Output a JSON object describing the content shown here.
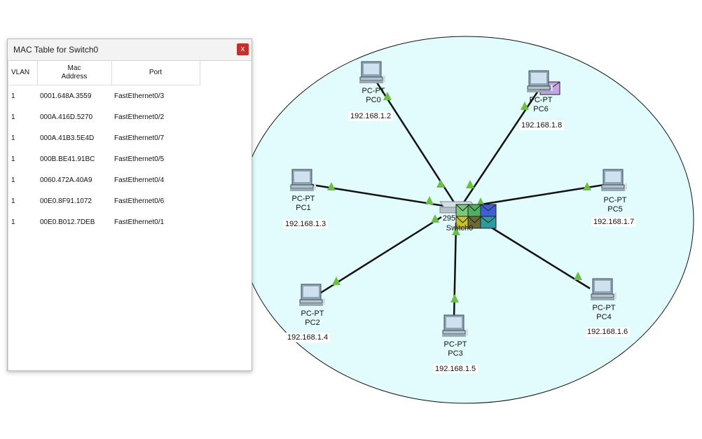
{
  "mac_window": {
    "title": "MAC Table for Switch0",
    "close_label": "x",
    "columns": {
      "vlan": "VLAN",
      "mac_line1": "Mac",
      "mac_line2": "Address",
      "port": "Port"
    },
    "rows": [
      {
        "vlan": "1",
        "mac": "0001.648A.3559",
        "port": "FastEthernet0/3"
      },
      {
        "vlan": "1",
        "mac": "000A.416D.5270",
        "port": "FastEthernet0/2"
      },
      {
        "vlan": "1",
        "mac": "000A.41B3.5E4D",
        "port": "FastEthernet0/7"
      },
      {
        "vlan": "1",
        "mac": "000B.BE41.91BC",
        "port": "FastEthernet0/5"
      },
      {
        "vlan": "1",
        "mac": "0060.472A.40A9",
        "port": "FastEthernet0/4"
      },
      {
        "vlan": "1",
        "mac": "00E0.8F91.1072",
        "port": "FastEthernet0/6"
      },
      {
        "vlan": "1",
        "mac": "00E0.B012.7DEB",
        "port": "FastEthernet0/1"
      }
    ]
  },
  "topology": {
    "switch": {
      "model": "295",
      "name": "Switch0"
    },
    "pcs": [
      {
        "type": "PC-PT",
        "name": "PC0",
        "ip": "192.168.1.2"
      },
      {
        "type": "PC-PT",
        "name": "PC1",
        "ip": "192.168.1.3"
      },
      {
        "type": "PC-PT",
        "name": "PC2",
        "ip": "192.168.1.4"
      },
      {
        "type": "PC-PT",
        "name": "PC3",
        "ip": "192.168.1.5"
      },
      {
        "type": "PC-PT",
        "name": "PC4",
        "ip": "192.168.1.6"
      },
      {
        "type": "PC-PT",
        "name": "PC5",
        "ip": "192.168.1.7"
      },
      {
        "type": "PC-PT",
        "name": "PC6",
        "ip": "192.168.1.8"
      }
    ]
  },
  "colors": {
    "ellipse_fill": "#e2fbfc",
    "link_up": "#6fbe44",
    "pdu_colors": [
      "#c7a6e8",
      "#78c97a",
      "#3f7fd9",
      "#c9c22f",
      "#6b6b3a",
      "#2f9aa0"
    ]
  }
}
